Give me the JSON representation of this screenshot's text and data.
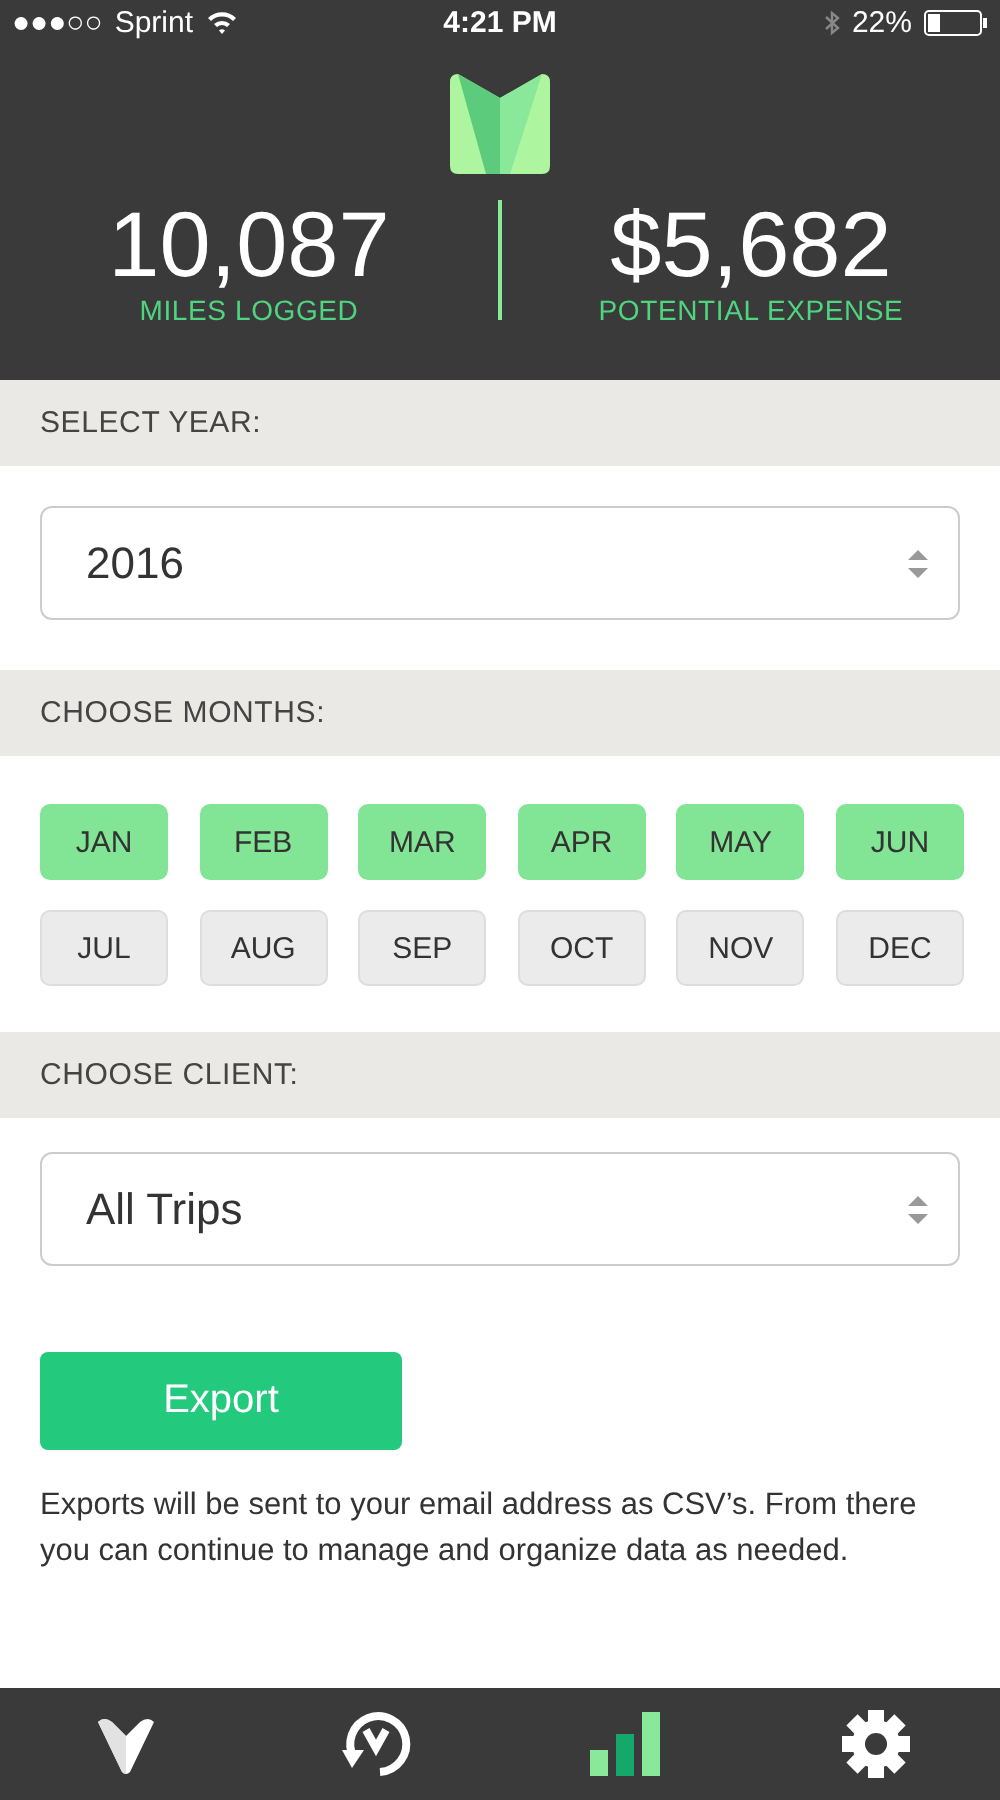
{
  "status_bar": {
    "signal": "●●●○○",
    "carrier": "Sprint",
    "time": "4:21 PM",
    "battery": "22%"
  },
  "stats": [
    {
      "value": "10,087",
      "label": "MILES LOGGED"
    },
    {
      "value": "$5,682",
      "label": "POTENTIAL EXPENSE"
    }
  ],
  "year_section": {
    "heading": "SELECT YEAR:",
    "value": "2016"
  },
  "months_section": {
    "heading": "CHOOSE MONTHS:",
    "months": [
      {
        "label": "JAN",
        "selected": true
      },
      {
        "label": "FEB",
        "selected": true
      },
      {
        "label": "MAR",
        "selected": true
      },
      {
        "label": "APR",
        "selected": true
      },
      {
        "label": "MAY",
        "selected": true
      },
      {
        "label": "JUN",
        "selected": true
      },
      {
        "label": "JUL",
        "selected": false
      },
      {
        "label": "AUG",
        "selected": false
      },
      {
        "label": "SEP",
        "selected": false
      },
      {
        "label": "OCT",
        "selected": false
      },
      {
        "label": "NOV",
        "selected": false
      },
      {
        "label": "DEC",
        "selected": false
      }
    ]
  },
  "client_section": {
    "heading": "CHOOSE CLIENT:",
    "value": "All Trips"
  },
  "export_button": "Export",
  "note": "Exports will be sent to your email address as CSV’s. From there you can continue to manage and organize data as needed.",
  "tab_bar": [
    {
      "kind": "home",
      "selected": false
    },
    {
      "kind": "history",
      "selected": false
    },
    {
      "kind": "reports",
      "selected": true
    },
    {
      "kind": "settings",
      "selected": false
    }
  ]
}
